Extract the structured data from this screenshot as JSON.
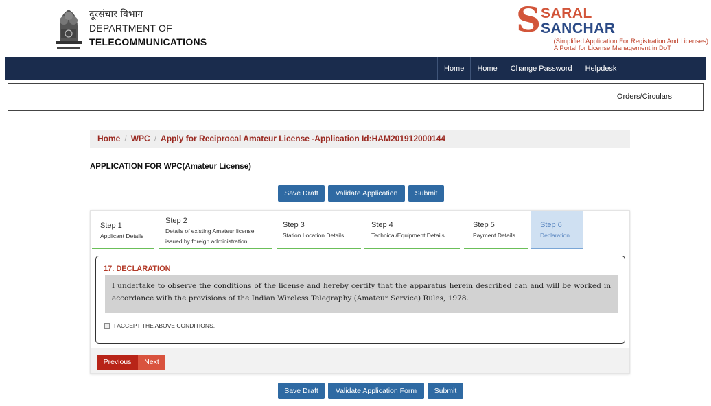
{
  "header": {
    "dept_hindi": "दूरसंचार विभाग",
    "dept_line1": "DEPARTMENT OF",
    "dept_line2": "TELECOMMUNICATIONS",
    "brand_word1": "SARAL",
    "brand_word2": "SANCHAR",
    "brand_tag1": "(Simplified Application For Registration And Licenses)",
    "brand_tag2": "A Portal for License Management in DoT",
    "brand_color": "#d2553a"
  },
  "nav": {
    "items": [
      "Home",
      "Home",
      "Change Password",
      "Helpdesk"
    ],
    "bg_color": "#1a2c4d"
  },
  "subnav": {
    "orders": "Orders/Circulars"
  },
  "breadcrumb": {
    "home": "Home",
    "wpc": "WPC",
    "current": "Apply for Reciprocal Amateur License -Application Id:HAM201912000144"
  },
  "page": {
    "title": "APPLICATION FOR WPC(Amateur License)"
  },
  "top_actions": {
    "save_draft": "Save Draft",
    "validate": "Validate Application",
    "submit": "Submit"
  },
  "steps": [
    {
      "title": "Step 1",
      "desc": "Applicant Details",
      "desc2": ""
    },
    {
      "title": "Step 2",
      "desc": "Details of existing Amateur license",
      "desc2": "issued by foreign administration"
    },
    {
      "title": "Step 3",
      "desc": "Station Location Details",
      "desc2": ""
    },
    {
      "title": "Step 4",
      "desc": "Technical/Equipment Details",
      "desc2": ""
    },
    {
      "title": "Step 5",
      "desc": "Payment Details",
      "desc2": ""
    },
    {
      "title": "Step 6",
      "desc": "Declaration",
      "desc2": "",
      "active": true
    }
  ],
  "declaration": {
    "title": "17. DECLARATION",
    "text": "I undertake to observe the conditions of the license and hereby certify that the apparatus herein described can and will be worked in accordance with the provisions of the Indian Wireless Telegraphy (Amateur Service) Rules, 1978.",
    "accept_label": "I ACCEPT THE ABOVE CONDITIONS.",
    "accepted": false
  },
  "pager": {
    "previous": "Previous",
    "next": "Next"
  },
  "bottom_actions": {
    "save_draft": "Save Draft",
    "validate": "Validate Application Form",
    "submit": "Submit"
  },
  "colors": {
    "primary_button": "#2f6aa3",
    "previous_button": "#b82418",
    "next_button": "#d9533e",
    "step_underline": "#6bbf59",
    "active_step_bg": "#cfe0f2"
  }
}
